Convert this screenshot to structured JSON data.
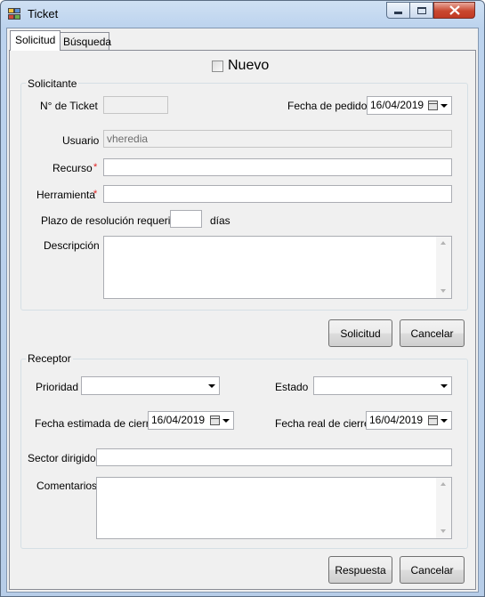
{
  "window": {
    "title": "Ticket"
  },
  "tabs": [
    {
      "label": "Solicitud",
      "active": true
    },
    {
      "label": "Búsqueda",
      "active": false
    }
  ],
  "nuevo": {
    "label": "Nuevo",
    "checked": false
  },
  "solicitante": {
    "title": "Solicitante",
    "ticket_label": "N° de Ticket",
    "ticket_value": "",
    "fecha_pedido_label": "Fecha de pedido",
    "fecha_pedido_value": "16/04/2019",
    "usuario_label": "Usuario",
    "usuario_value": "vheredia",
    "recurso_label": "Recurso",
    "recurso_value": "",
    "herramienta_label": "Herramienta",
    "herramienta_value": "",
    "required_mark": "*",
    "plazo_label": "Plazo de resolución requerido",
    "plazo_value": "",
    "dias_label": "días",
    "descripcion_label": "Descripción",
    "descripcion_value": ""
  },
  "solicitud_actions": {
    "submit": "Solicitud",
    "cancel": "Cancelar"
  },
  "receptor": {
    "title": "Receptor",
    "prioridad_label": "Prioridad",
    "prioridad_value": "",
    "estado_label": "Estado",
    "estado_value": "",
    "fecha_estimada_label": "Fecha estimada de cierre",
    "fecha_estimada_value": "16/04/2019",
    "fecha_real_label": "Fecha real de cierre",
    "fecha_real_value": "16/04/2019",
    "sector_label": "Sector dirigido",
    "sector_value": "",
    "comentarios_label": "Comentarios",
    "comentarios_value": ""
  },
  "receptor_actions": {
    "submit": "Respuesta",
    "cancel": "Cancelar"
  }
}
